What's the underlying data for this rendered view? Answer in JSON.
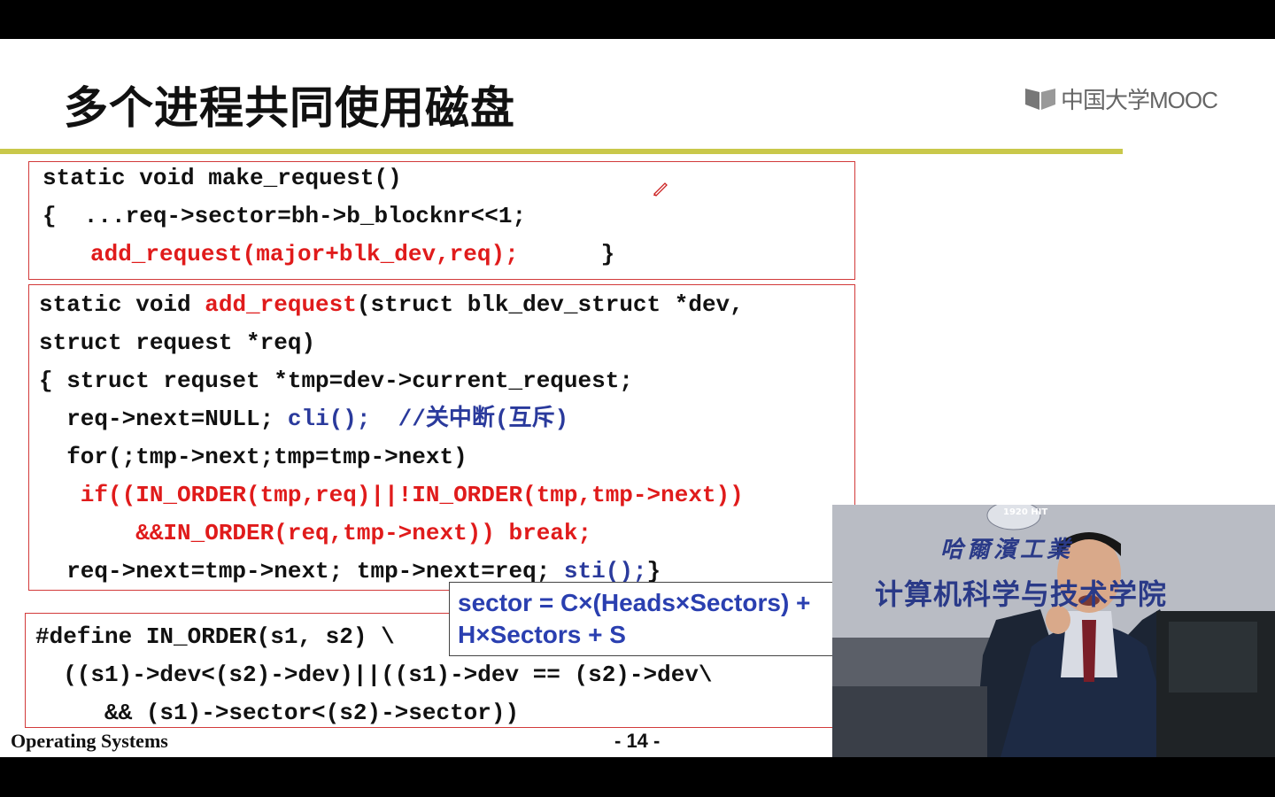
{
  "slide": {
    "title": "多个进程共同使用磁盘",
    "logo_text": "中国大学MOOC",
    "accent_rule_color": "#c9c84a",
    "box_border_color": "#d23a3a"
  },
  "code_box_1": {
    "lines": [
      "static void make_request()",
      "{  ...req->sector=bh->b_blocknr<<1;",
      "add_request(major+blk_dev,req);",
      " }"
    ]
  },
  "code_box_2": {
    "line1_a": "static void ",
    "line1_b": "add_request",
    "line1_c": "(struct blk_dev_struct *dev,",
    "line2": "struct request *req)",
    "line3": "{ struct requset *tmp=dev->current_request;",
    "line4_a": "  req->next=NULL; ",
    "line4_b": "cli();  //关中断(互斥)",
    "line5": "  for(;tmp->next;tmp=tmp->next)",
    "line6": "   if((IN_ORDER(tmp,req)||!IN_ORDER(tmp,tmp->next))",
    "line7": "       &&IN_ORDER(req,tmp->next)) break;",
    "line8_a": "  req->next=tmp->next; tmp->next=req; ",
    "line8_b": "sti();",
    "line8_c": "}"
  },
  "code_box_3": {
    "lines": [
      "#define IN_ORDER(s1, s2) \\",
      "  ((s1)->dev<(s2)->dev)||((s1)->dev == (s2)->dev\\",
      "     && (s1)->sector<(s2)->sector))"
    ]
  },
  "formula": {
    "line1": "sector = C×(Heads×Sectors) +",
    "line2": "H×Sectors + S"
  },
  "footer": {
    "course": "Operating Systems",
    "page": "- 14 -"
  },
  "webcam": {
    "emblem_text": "1920 HIT",
    "caption_line1": "哈爾濱工業",
    "caption_line2": "计算机科学与技术学院"
  }
}
